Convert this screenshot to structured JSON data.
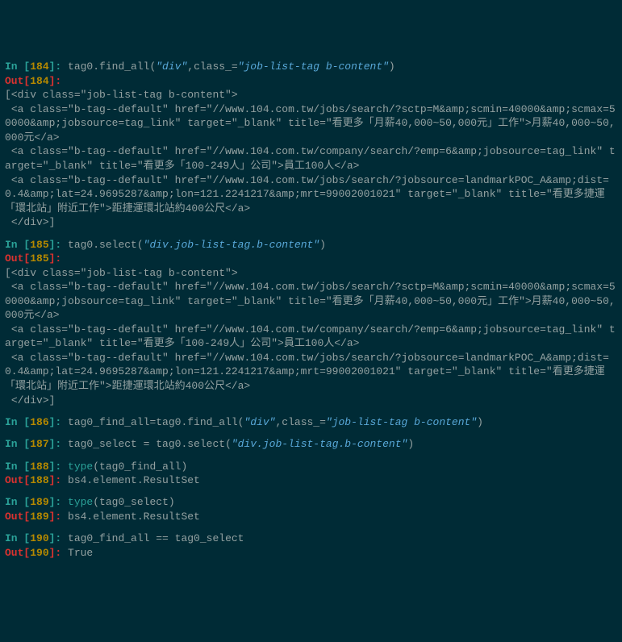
{
  "cells": [
    {
      "n": "184",
      "in_parts": [
        {
          "t": "code",
          "v": "tag0.find_all("
        },
        {
          "t": "str",
          "v": "\"div\""
        },
        {
          "t": "code",
          "v": ",class_="
        },
        {
          "t": "str",
          "v": "\"job-list-tag b-content\""
        },
        {
          "t": "code",
          "v": ")"
        }
      ],
      "out": "[<div class=\"job-list-tag b-content\">\n <a class=\"b-tag--default\" href=\"//www.104.com.tw/jobs/search/?sctp=M&amp;scmin=40000&amp;scmax=50000&amp;jobsource=tag_link\" target=\"_blank\" title=\"看更多「月薪40,000~50,000元」工作\">月薪40,000~50,000元</a>\n <a class=\"b-tag--default\" href=\"//www.104.com.tw/company/search/?emp=6&amp;jobsource=tag_link\" target=\"_blank\" title=\"看更多「100-249人」公司\">員工100人</a>\n <a class=\"b-tag--default\" href=\"//www.104.com.tw/jobs/search/?jobsource=landmarkPOC_A&amp;dist=0.4&amp;lat=24.9695287&amp;lon=121.2241217&amp;mrt=99002001021\" target=\"_blank\" title=\"看更多捷運「環北站」附近工作\">距捷運環北站約400公尺</a>\n </div>]"
    },
    {
      "n": "185",
      "in_parts": [
        {
          "t": "code",
          "v": "tag0.select("
        },
        {
          "t": "str",
          "v": "\"div.job-list-tag.b-content\""
        },
        {
          "t": "code",
          "v": ")"
        }
      ],
      "out": "[<div class=\"job-list-tag b-content\">\n <a class=\"b-tag--default\" href=\"//www.104.com.tw/jobs/search/?sctp=M&amp;scmin=40000&amp;scmax=50000&amp;jobsource=tag_link\" target=\"_blank\" title=\"看更多「月薪40,000~50,000元」工作\">月薪40,000~50,000元</a>\n <a class=\"b-tag--default\" href=\"//www.104.com.tw/company/search/?emp=6&amp;jobsource=tag_link\" target=\"_blank\" title=\"看更多「100-249人」公司\">員工100人</a>\n <a class=\"b-tag--default\" href=\"//www.104.com.tw/jobs/search/?jobsource=landmarkPOC_A&amp;dist=0.4&amp;lat=24.9695287&amp;lon=121.2241217&amp;mrt=99002001021\" target=\"_blank\" title=\"看更多捷運「環北站」附近工作\">距捷運環北站約400公尺</a>\n </div>]"
    },
    {
      "n": "186",
      "in_parts": [
        {
          "t": "code",
          "v": "tag0_find_all=tag0.find_all("
        },
        {
          "t": "str",
          "v": "\"div\""
        },
        {
          "t": "code",
          "v": ",class_="
        },
        {
          "t": "str",
          "v": "\"job-list-tag b-content\""
        },
        {
          "t": "code",
          "v": ")"
        }
      ],
      "out": null
    },
    {
      "n": "187",
      "in_parts": [
        {
          "t": "code",
          "v": "tag0_select = tag0.select("
        },
        {
          "t": "str",
          "v": "\"div.job-list-tag.b-content\""
        },
        {
          "t": "code",
          "v": ")"
        }
      ],
      "out": null
    },
    {
      "n": "188",
      "in_parts": [
        {
          "t": "func",
          "v": "type"
        },
        {
          "t": "code",
          "v": "(tag0_find_all)"
        }
      ],
      "out": "bs4.element.ResultSet"
    },
    {
      "n": "189",
      "in_parts": [
        {
          "t": "func",
          "v": "type"
        },
        {
          "t": "code",
          "v": "(tag0_select)"
        }
      ],
      "out": "bs4.element.ResultSet"
    },
    {
      "n": "190",
      "in_parts": [
        {
          "t": "code",
          "v": "tag0_find_all == tag0_select"
        }
      ],
      "out": "True"
    }
  ],
  "labels": {
    "in_prefix": "In [",
    "in_suffix": "]: ",
    "out_prefix": "Out[",
    "out_suffix": "]: "
  }
}
